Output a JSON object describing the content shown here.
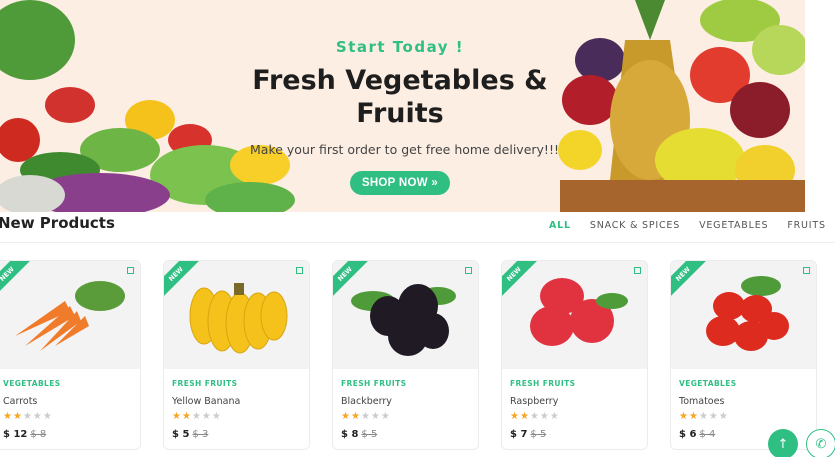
{
  "hero": {
    "kicker": "Start Today !",
    "title_line1": "Fresh Vegetables &",
    "title_line2": "Fruits",
    "subtitle": "Make your first order to get free home delivery!!!",
    "button": "SHOP NOW »"
  },
  "section": {
    "title": "New Products",
    "tabs": [
      "ALL",
      "SNACK & SPICES",
      "VEGETABLES",
      "FRUITS"
    ]
  },
  "products": [
    {
      "badge": "NEW",
      "category": "VEGETABLES",
      "name": "Carrots",
      "rating": 2,
      "price": "$ 12",
      "old_price": "$ 8",
      "image": "carrot-image"
    },
    {
      "badge": "NEW",
      "category": "FRESH FRUITS",
      "name": "Yellow Banana",
      "rating": 2,
      "price": "$ 5",
      "old_price": "$ 3",
      "image": "banana-image"
    },
    {
      "badge": "NEW",
      "category": "FRESH FRUITS",
      "name": "Blackberry",
      "rating": 2,
      "price": "$ 8",
      "old_price": "$ 5",
      "image": "blackberry-image"
    },
    {
      "badge": "NEW",
      "category": "FRESH FRUITS",
      "name": "Raspberry",
      "rating": 2,
      "price": "$ 7",
      "old_price": "$ 5",
      "image": "raspberry-image"
    },
    {
      "badge": "NEW",
      "category": "VEGETABLES",
      "name": "Tomatoes",
      "rating": 2,
      "price": "$ 6",
      "old_price": "$ 4",
      "image": "tomato-image"
    }
  ],
  "fabs": {
    "scroll_top": "↑",
    "phone": "✆"
  },
  "colors": {
    "accent": "#2fbf83",
    "hero_bg": "#fdeee4",
    "star": "#f6a623"
  }
}
